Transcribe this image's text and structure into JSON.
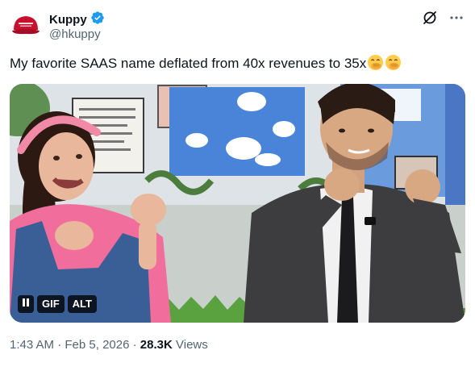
{
  "author": {
    "display_name": "Kuppy",
    "handle": "@hkuppy",
    "verified": true,
    "verified_color": "#1d9bf0"
  },
  "icons": {
    "avatar": "red-cap-avatar",
    "verified": "verified-badge-icon",
    "grok": "grok-icon",
    "more": "more-icon"
  },
  "tweet": {
    "text": "My favorite SAAS name deflated from 40x revenues to 35x",
    "emojis": [
      "face-with-hand-over-mouth",
      "face-with-hand-over-mouth"
    ]
  },
  "media": {
    "pause_label": "II",
    "gif_label": "GIF",
    "alt_label": "ALT"
  },
  "meta": {
    "time": "1:43 AM",
    "separator": "·",
    "date": "Feb 5, 2026",
    "views_count": "28.3K",
    "views_label": "Views"
  }
}
